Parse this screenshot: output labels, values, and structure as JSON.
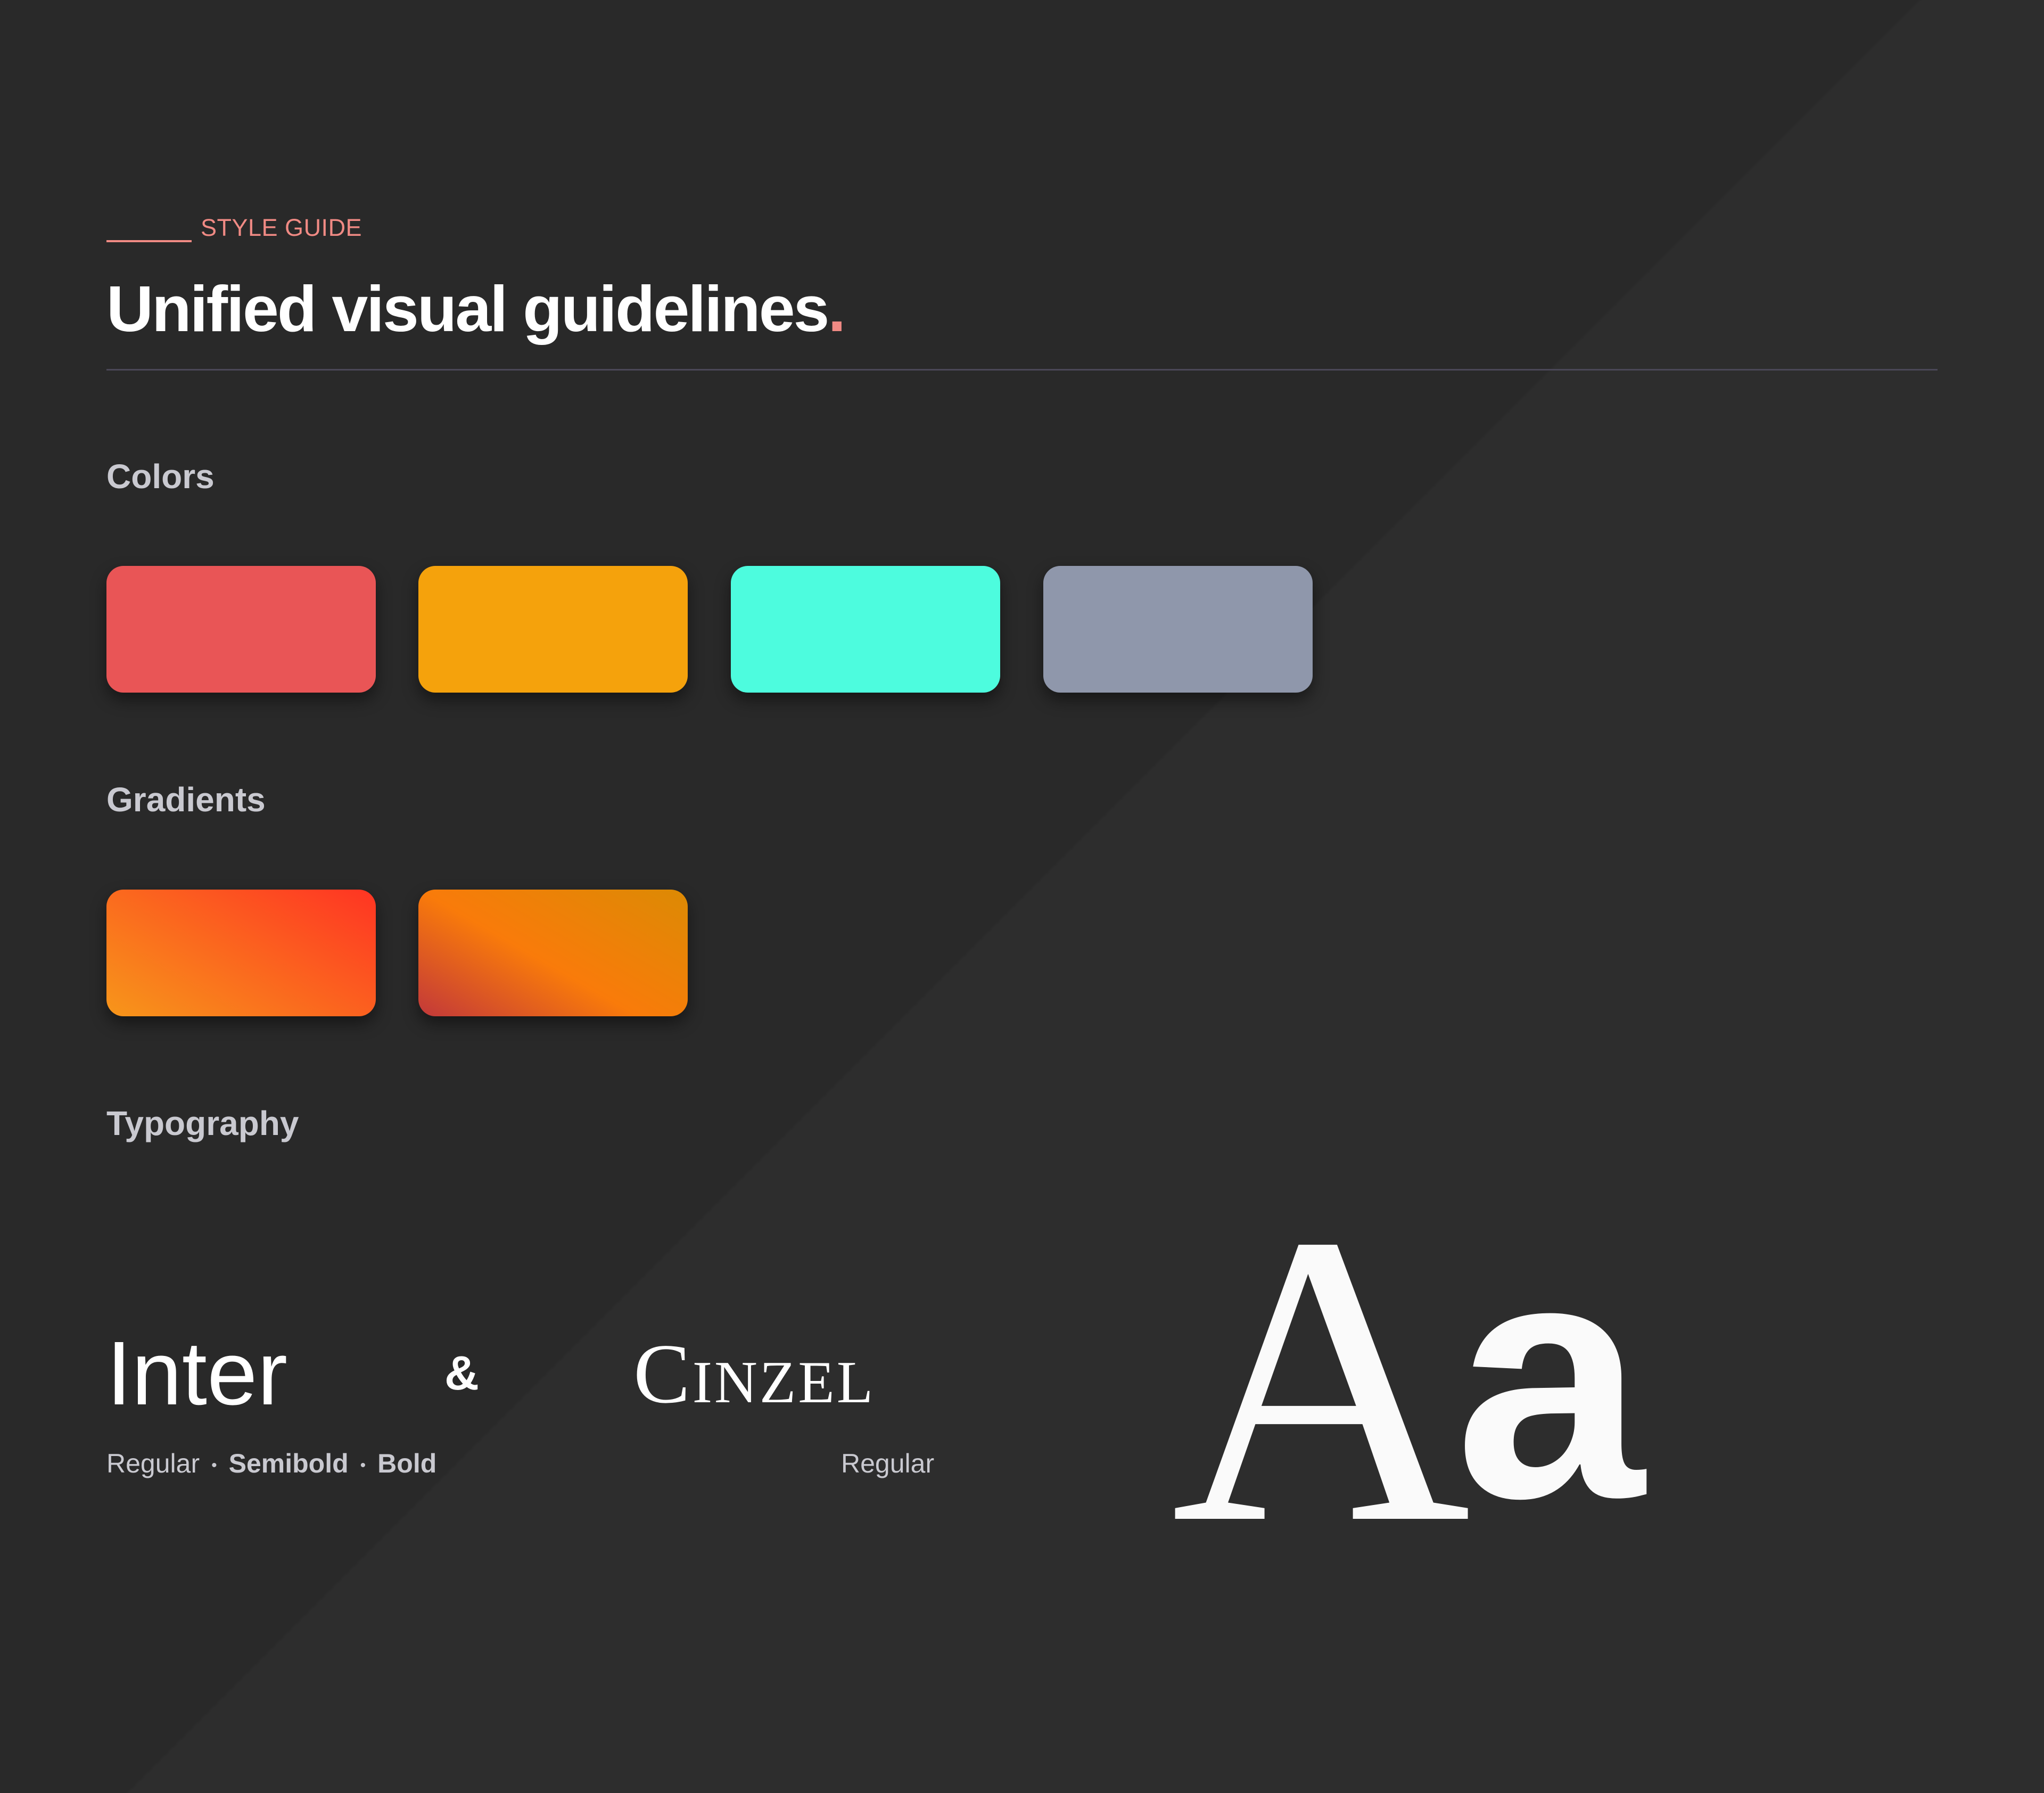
{
  "header": {
    "tag": "STYLE GUIDE",
    "title": "Unified visual guidelines",
    "title_dot": "."
  },
  "sections": {
    "colors": "Colors",
    "gradients": "Gradients",
    "typography": "Typography"
  },
  "colors": [
    "#e95556",
    "#f5a20c",
    "#4dfcde",
    "#8f97ab"
  ],
  "gradients": [
    {
      "from": "#f7961a",
      "to": "#ff3423"
    },
    {
      "from": "#c2383a",
      "mid": "#f97b0a",
      "to": "#dc8a04"
    }
  ],
  "typography": {
    "primary_font": "Inter",
    "ampersand": "&",
    "secondary_font": "Cinzel",
    "primary_weights": [
      "Regular",
      "Semibold",
      "Bold"
    ],
    "weight_separator": "•",
    "secondary_weight": "Regular",
    "sample_upper": "A",
    "sample_lower": "a"
  }
}
